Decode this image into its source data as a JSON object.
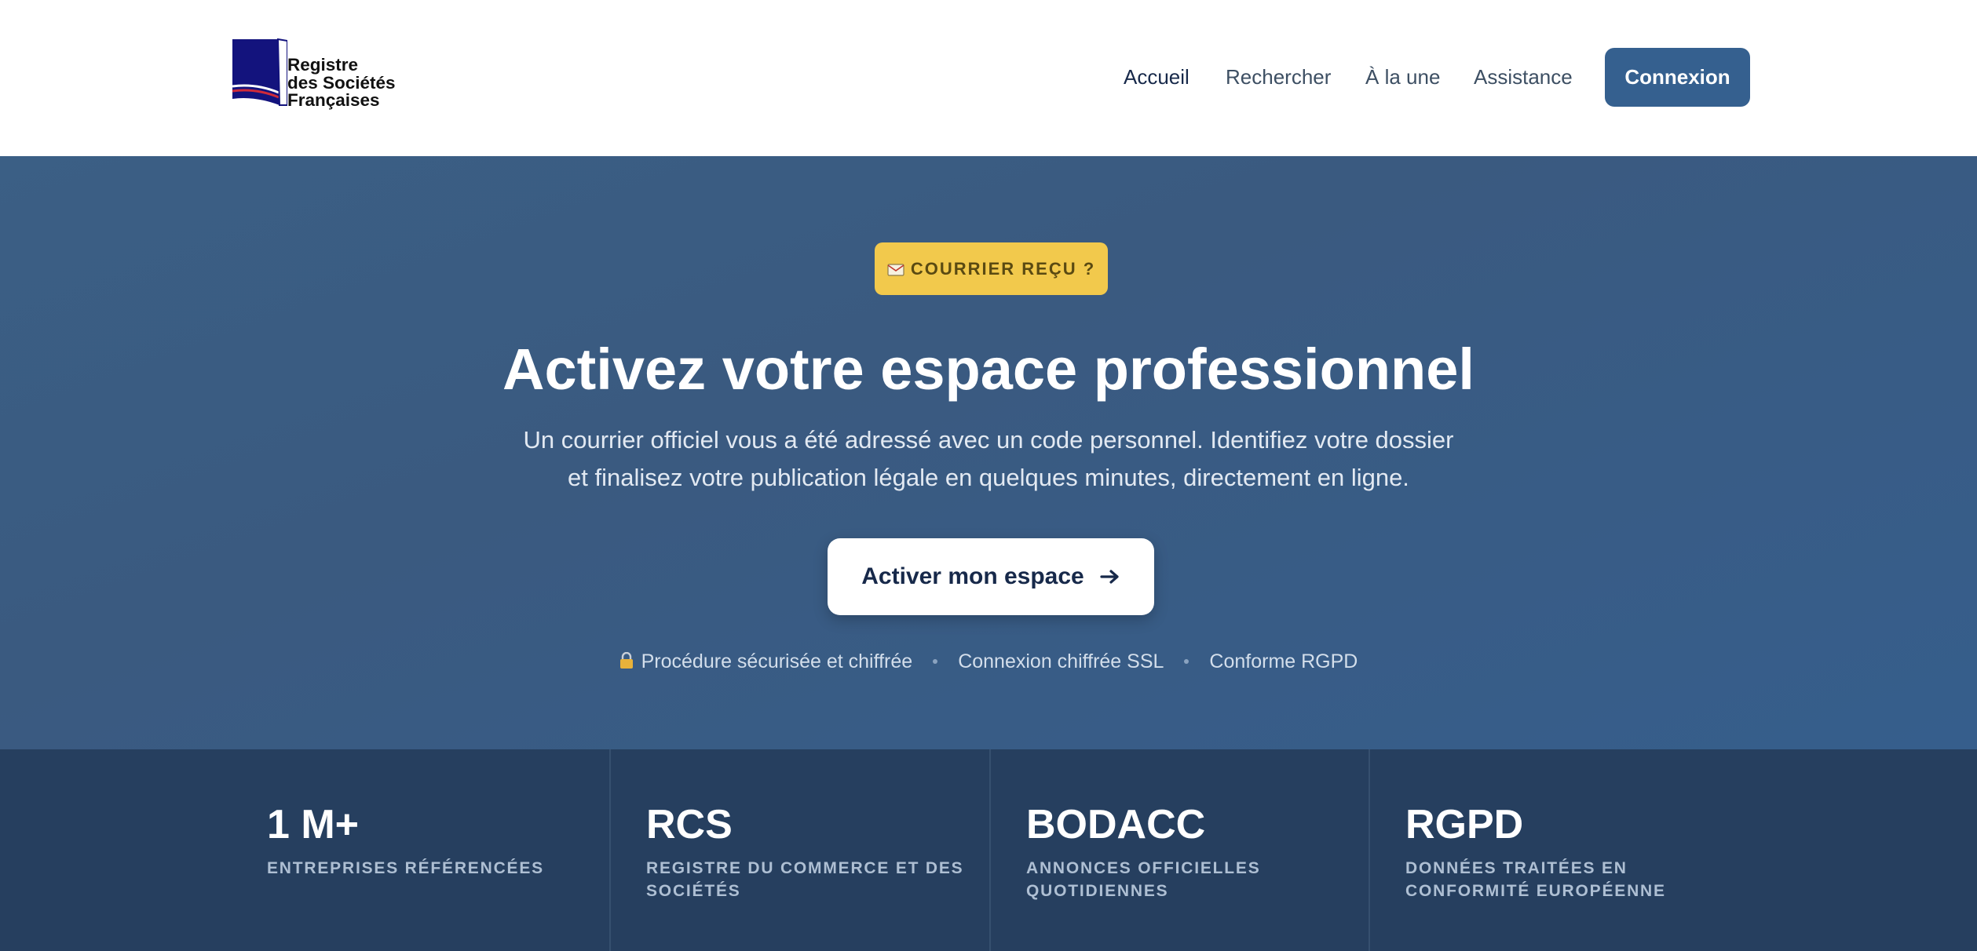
{
  "header": {
    "logo": {
      "line1": "Registre",
      "line2": "des Sociétés",
      "line3": "Françaises",
      "icon": "book-flag-logo"
    },
    "nav": [
      {
        "label": "Accueil",
        "active": true
      },
      {
        "label": "Rechercher",
        "active": false
      },
      {
        "label": "À la une",
        "active": false
      },
      {
        "label": "Assistance",
        "active": false
      }
    ],
    "login_label": "Connexion"
  },
  "hero": {
    "badge": {
      "icon": "mail-icon",
      "label": "COURRIER REÇU ?"
    },
    "title": "Activez votre espace professionnel",
    "subtitle_line1": "Un courrier officiel vous a été adressé avec un code personnel. Identifiez votre dossier",
    "subtitle_line2": "et finalisez votre publication légale en quelques minutes, directement en ligne.",
    "cta": {
      "label": "Activer mon espace",
      "icon": "arrow-right-icon"
    },
    "trust": [
      {
        "icon": "lock-icon",
        "label": "Procédure sécurisée et chiffrée"
      },
      {
        "label": "Connexion chiffrée SSL"
      },
      {
        "label": "Conforme RGPD"
      }
    ]
  },
  "stats": [
    {
      "value": "1 M+",
      "label": "ENTREPRISES RÉFÉRENCÉES"
    },
    {
      "value": "RCS",
      "label": "REGISTRE DU COMMERCE ET DES SOCIÉTÉS"
    },
    {
      "value": "BODACC",
      "label": "ANNONCES OFFICIELLES QUOTIDIENNES"
    },
    {
      "value": "RGPD",
      "label": "DONNÉES TRAITÉES EN CONFORMITÉ EUROPÉENNE"
    }
  ],
  "colors": {
    "brand_blue": "#35608f",
    "navy": "#17294a",
    "hero_bg": "#3a5a80",
    "stats_bg": "#263f5f",
    "badge_yellow": "#f2c94c"
  }
}
